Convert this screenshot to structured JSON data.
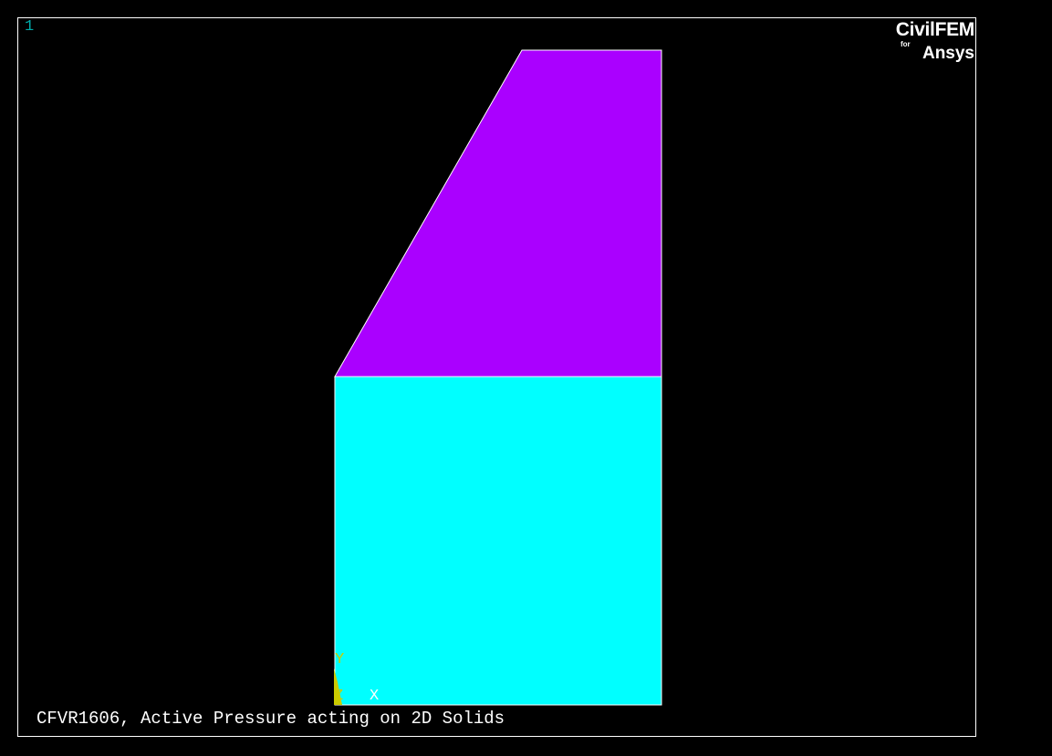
{
  "window": {
    "number": "1",
    "number_color": "#00aaaa"
  },
  "logo": {
    "main": "CivilFEM",
    "for": "for",
    "sub": "Ansys"
  },
  "model": {
    "areas": [
      {
        "name": "upper-trapezoid-area",
        "color": "#aa00ff"
      },
      {
        "name": "lower-rectangle-area",
        "color": "#00ffff"
      }
    ],
    "edge_color": "#ffffff"
  },
  "triad": {
    "y_label": "Y",
    "z_label": "Z",
    "x_label": "X",
    "y_color": "#cccc00",
    "z_color": "#cccc00",
    "x_color": "#ffffff",
    "marker_color": "#cccc00"
  },
  "caption": "CFVR1606, Active Pressure acting on 2D Solids"
}
